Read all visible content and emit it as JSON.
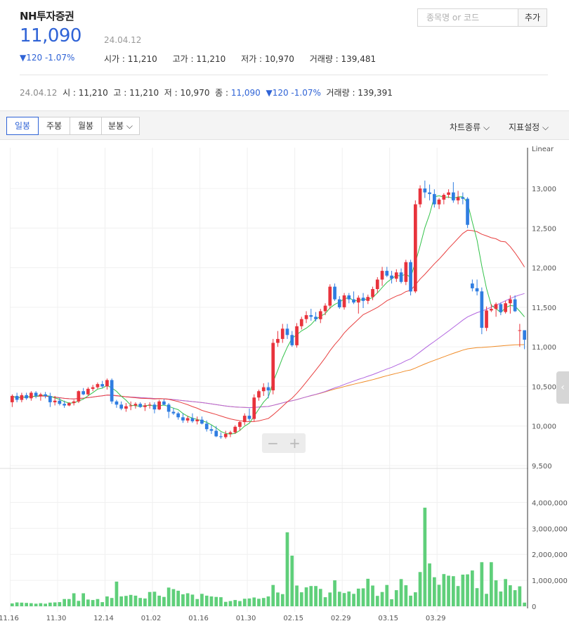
{
  "header": {
    "stock_name": "NH투자증권",
    "price": "11,090",
    "date": "24.04.12",
    "change": "▼120 -1.07%",
    "open": "시가 : 11,210",
    "high": "고가 : 11,210",
    "low": "저가 : 10,970",
    "volume": "거래량 : 139,481"
  },
  "search": {
    "placeholder": "종목명 or 코드",
    "add_label": "추가"
  },
  "ohlc_line": {
    "date": "24.04.12",
    "open": "시 : 11,210",
    "high": "고 : 11,210",
    "low": "저 : 10,970",
    "close_label": "종 : ",
    "close_value": "11,090",
    "change": "▼120 -1.07%",
    "volume": "거래량 : 139,391"
  },
  "toolbar": {
    "periods": [
      "일봉",
      "주봉",
      "월봉",
      "분봉 ⌵"
    ],
    "active_period": "일봉",
    "chart_type": "차트종류 ⌵",
    "indicator": "지표설정 ⌵"
  },
  "colors": {
    "up": "#e8333c",
    "down": "#2f7de1",
    "ma5": "#33c24a",
    "ma20": "#e84040",
    "ma60": "#b266e0",
    "ma120": "#f08c28",
    "volume": "#5fcf7a",
    "accent": "#2f63d6"
  },
  "chart_data": {
    "type": "candlestick",
    "scale_label": "Linear",
    "x_tick_labels": [
      "11.16",
      "11.30",
      "12.14",
      "01.02",
      "01.16",
      "01.30",
      "02.15",
      "02.29",
      "03.15",
      "03.29"
    ],
    "x_tick_index": [
      0,
      10,
      20,
      30,
      40,
      50,
      60,
      70,
      80,
      90
    ],
    "price_ticks": [
      9500,
      10000,
      10500,
      11000,
      11500,
      12000,
      12500,
      13000
    ],
    "price_range": [
      9500,
      13200
    ],
    "volume_ticks": [
      0,
      1000000,
      2000000,
      3000000,
      4000000
    ],
    "volume_range": [
      0,
      4200000
    ],
    "candles": [
      [
        10300,
        10400,
        10240,
        10380
      ],
      [
        10380,
        10420,
        10300,
        10330
      ],
      [
        10330,
        10420,
        10300,
        10390
      ],
      [
        10390,
        10420,
        10330,
        10350
      ],
      [
        10350,
        10440,
        10320,
        10420
      ],
      [
        10420,
        10440,
        10350,
        10380
      ],
      [
        10380,
        10420,
        10320,
        10400
      ],
      [
        10400,
        10430,
        10350,
        10380
      ],
      [
        10380,
        10420,
        10240,
        10300
      ],
      [
        10300,
        10380,
        10260,
        10320
      ],
      [
        10320,
        10360,
        10260,
        10280
      ],
      [
        10280,
        10320,
        10230,
        10260
      ],
      [
        10260,
        10300,
        10250,
        10290
      ],
      [
        10290,
        10330,
        10260,
        10310
      ],
      [
        10310,
        10450,
        10290,
        10440
      ],
      [
        10440,
        10480,
        10390,
        10400
      ],
      [
        10400,
        10490,
        10380,
        10470
      ],
      [
        10470,
        10520,
        10440,
        10490
      ],
      [
        10490,
        10550,
        10470,
        10530
      ],
      [
        10530,
        10570,
        10480,
        10500
      ],
      [
        10500,
        10600,
        10460,
        10580
      ],
      [
        10580,
        10600,
        10280,
        10310
      ],
      [
        10310,
        10330,
        10230,
        10270
      ],
      [
        10270,
        10310,
        10200,
        10220
      ],
      [
        10220,
        10290,
        10180,
        10250
      ],
      [
        10250,
        10310,
        10200,
        10260
      ],
      [
        10260,
        10300,
        10220,
        10280
      ],
      [
        10280,
        10300,
        10230,
        10240
      ],
      [
        10240,
        10290,
        10190,
        10260
      ],
      [
        10260,
        10300,
        10220,
        10270
      ],
      [
        10270,
        10300,
        10160,
        10210
      ],
      [
        10210,
        10330,
        10200,
        10310
      ],
      [
        10310,
        10340,
        10260,
        10270
      ],
      [
        10270,
        10290,
        10100,
        10180
      ],
      [
        10180,
        10230,
        10140,
        10160
      ],
      [
        10160,
        10180,
        10080,
        10110
      ],
      [
        10110,
        10160,
        10040,
        10070
      ],
      [
        10070,
        10130,
        10040,
        10100
      ],
      [
        10100,
        10160,
        10040,
        10060
      ],
      [
        10060,
        10120,
        10020,
        10080
      ],
      [
        10080,
        10120,
        10020,
        10030
      ],
      [
        10030,
        10070,
        9930,
        9960
      ],
      [
        9960,
        10010,
        9900,
        9940
      ],
      [
        9940,
        10000,
        9860,
        9870
      ],
      [
        9870,
        9920,
        9840,
        9860
      ],
      [
        9860,
        9940,
        9840,
        9900
      ],
      [
        9900,
        9940,
        9860,
        9920
      ],
      [
        9920,
        10010,
        9900,
        9990
      ],
      [
        9990,
        10060,
        9940,
        10050
      ],
      [
        10050,
        10160,
        10010,
        10130
      ],
      [
        10130,
        10220,
        10060,
        10090
      ],
      [
        10090,
        10400,
        10060,
        10360
      ],
      [
        10360,
        10460,
        10320,
        10440
      ],
      [
        10440,
        10540,
        10380,
        10490
      ],
      [
        10490,
        10550,
        10350,
        10450
      ],
      [
        10450,
        11100,
        10400,
        11050
      ],
      [
        11050,
        11200,
        11000,
        11100
      ],
      [
        11100,
        11290,
        11050,
        11230
      ],
      [
        11230,
        11290,
        11100,
        11150
      ],
      [
        11150,
        11200,
        11000,
        11020
      ],
      [
        11020,
        11300,
        10990,
        11260
      ],
      [
        11260,
        11380,
        11220,
        11350
      ],
      [
        11350,
        11450,
        11300,
        11400
      ],
      [
        11400,
        11480,
        11330,
        11380
      ],
      [
        11380,
        11440,
        11320,
        11350
      ],
      [
        11350,
        11480,
        11300,
        11450
      ],
      [
        11450,
        11550,
        11400,
        11520
      ],
      [
        11520,
        11790,
        11480,
        11760
      ],
      [
        11760,
        11800,
        11580,
        11600
      ],
      [
        11600,
        11640,
        11480,
        11500
      ],
      [
        11500,
        11680,
        11470,
        11650
      ],
      [
        11650,
        11680,
        11550,
        11600
      ],
      [
        11600,
        11700,
        11540,
        11560
      ],
      [
        11560,
        11650,
        11420,
        11620
      ],
      [
        11620,
        11680,
        11490,
        11580
      ],
      [
        11580,
        11660,
        11540,
        11630
      ],
      [
        11630,
        11760,
        11590,
        11730
      ],
      [
        11730,
        11880,
        11680,
        11850
      ],
      [
        11850,
        12010,
        11770,
        11960
      ],
      [
        11960,
        12010,
        11880,
        11900
      ],
      [
        11900,
        11960,
        11800,
        11860
      ],
      [
        11860,
        11980,
        11820,
        11940
      ],
      [
        11940,
        11990,
        11800,
        11820
      ],
      [
        11820,
        12100,
        11780,
        12070
      ],
      [
        12070,
        12100,
        11650,
        11700
      ],
      [
        11700,
        12850,
        11680,
        12800
      ],
      [
        12800,
        13040,
        12760,
        13000
      ],
      [
        13000,
        13100,
        12880,
        12950
      ],
      [
        12950,
        13050,
        12850,
        12930
      ],
      [
        12930,
        12990,
        12760,
        12800
      ],
      [
        12800,
        12880,
        12740,
        12860
      ],
      [
        12860,
        12940,
        12800,
        12920
      ],
      [
        12920,
        12990,
        12880,
        12950
      ],
      [
        12950,
        13080,
        12820,
        12850
      ],
      [
        12850,
        12970,
        12800,
        12890
      ],
      [
        12890,
        12950,
        12800,
        12870
      ],
      [
        12870,
        12890,
        12500,
        12540
      ],
      [
        11800,
        11850,
        11700,
        11740
      ],
      [
        11740,
        11850,
        11650,
        11700
      ],
      [
        11700,
        11750,
        11160,
        11240
      ]
    ],
    "candles_tail": [
      [
        11240,
        11510,
        11200,
        11460
      ],
      [
        11460,
        11540,
        11440,
        11480
      ],
      [
        11480,
        11560,
        11380,
        11540
      ],
      [
        11540,
        11560,
        11400,
        11440
      ],
      [
        11440,
        11580,
        11420,
        11550
      ],
      [
        11550,
        11650,
        11420,
        11600
      ],
      [
        11600,
        11650,
        11440,
        11450
      ],
      [
        11210,
        11290,
        11000,
        11210
      ],
      [
        11210,
        11210,
        10970,
        11090
      ]
    ],
    "volume": [
      110000,
      150000,
      140000,
      130000,
      120000,
      100000,
      120000,
      100000,
      140000,
      150000,
      160000,
      280000,
      280000,
      500000,
      210000,
      500000,
      260000,
      240000,
      280000,
      160000,
      380000,
      320000,
      950000,
      380000,
      400000,
      440000,
      410000,
      320000,
      300000,
      550000,
      560000,
      410000,
      360000,
      720000,
      660000,
      600000,
      460000,
      500000,
      450000,
      280000,
      480000,
      410000,
      380000,
      360000,
      350000,
      170000,
      200000,
      240000,
      200000,
      290000,
      300000,
      340000,
      290000,
      320000,
      380000,
      820000,
      530000,
      470000,
      2850000,
      1950000,
      800000,
      540000,
      730000,
      780000,
      780000,
      670000,
      350000,
      530000,
      1000000,
      560000,
      510000,
      570000,
      480000,
      680000,
      690000,
      1060000,
      800000,
      400000,
      550000,
      820000,
      270000,
      620000,
      1050000,
      810000,
      410000,
      540000,
      1320000,
      3800000,
      1650000,
      1120000,
      830000,
      1240000,
      1180000,
      1160000,
      780000,
      1220000,
      1230000,
      1380000,
      700000,
      1700000
    ],
    "volume_tail": [
      480000,
      1700000,
      1000000,
      570000,
      1050000,
      810000,
      620000,
      770000,
      140000
    ]
  }
}
